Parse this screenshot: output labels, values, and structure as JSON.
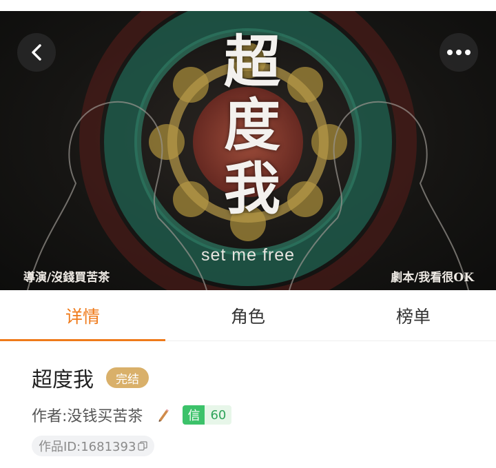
{
  "hero": {
    "title_chars": [
      "超",
      "度",
      "我"
    ],
    "subtitle": "set me free",
    "credit_left": "導演/沒錢買苦茶",
    "credit_right": "劇本/我看很OK"
  },
  "nav": {
    "back_icon": "chevron-left-icon",
    "more_icon": "more-dots-icon"
  },
  "tabs": [
    {
      "label": "详情",
      "active": true
    },
    {
      "label": "角色",
      "active": false
    },
    {
      "label": "榜单",
      "active": false
    }
  ],
  "work": {
    "title": "超度我",
    "status": "完结",
    "author_label": "作者:",
    "author_name": "没钱买苦茶",
    "credit_label": "信",
    "credit_score": "60",
    "id_text": "作品ID:1681393"
  },
  "colors": {
    "accent": "#ef7a1a",
    "status_badge": "#d9b06a",
    "credit_green": "#3cc26a"
  }
}
